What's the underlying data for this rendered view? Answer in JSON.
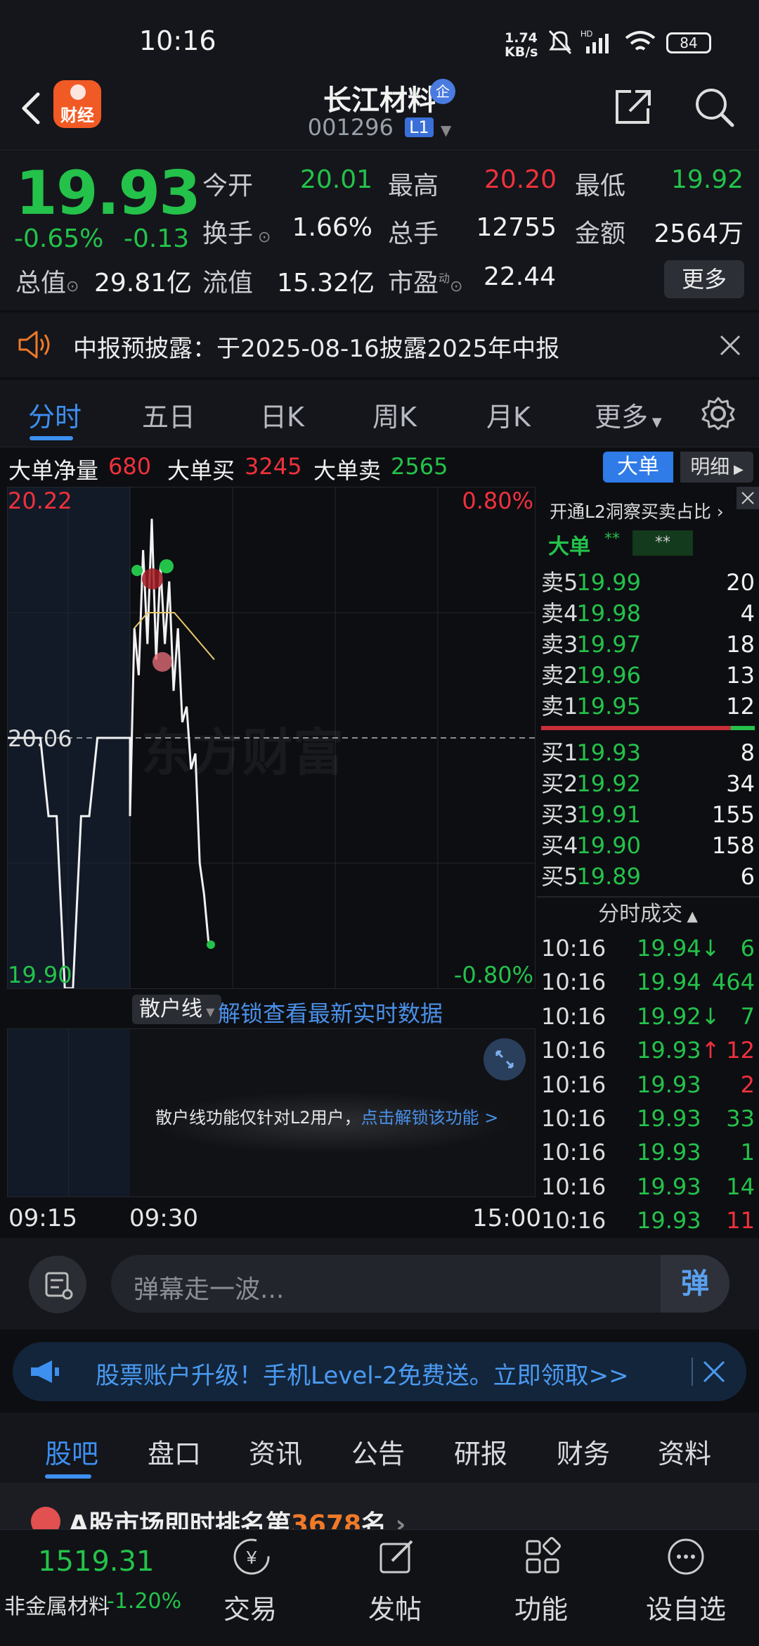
{
  "status_bar": {
    "time": "10:16",
    "net_speed_value": "1.74",
    "net_speed_unit": "KB/s",
    "battery": "84"
  },
  "header": {
    "app_badge": "财经",
    "stock_name": "长江材料",
    "verified_badge": "企",
    "stock_code": "001296",
    "level": "L1"
  },
  "quote": {
    "price": "19.93",
    "change_pct": "-0.65%",
    "change_amt": "-0.13",
    "open_label": "今开",
    "open": "20.01",
    "high_label": "最高",
    "high": "20.20",
    "low_label": "最低",
    "low": "19.92",
    "turnover_label": "换手",
    "turnover": "1.66%",
    "volume_label": "总手",
    "volume": "12755",
    "amount_label": "金额",
    "amount": "2564万",
    "mktcap_label": "总值",
    "mktcap": "29.81亿",
    "float_label": "流值",
    "float": "15.32亿",
    "pe_label": "市盈",
    "pe_sup": "动",
    "pe": "22.44",
    "more_label": "更多"
  },
  "notice": {
    "text": "中报预披露：于2025-08-16披露2025年中报"
  },
  "chart_tabs": [
    "分时",
    "五日",
    "日K",
    "周K",
    "月K",
    "更多"
  ],
  "big_order": {
    "net_label": "大单净量",
    "net": "680",
    "buy_label": "大单买",
    "buy": "3245",
    "sell_label": "大单卖",
    "sell": "2565",
    "tab_big": "大单",
    "tab_detail": "明细"
  },
  "chart": {
    "top_price": "20.22",
    "top_pct": "0.80%",
    "mid_price": "20.06",
    "bottom_price": "19.90",
    "bottom_pct": "-0.80%",
    "watermark": "东方财富"
  },
  "chart_data": {
    "type": "line",
    "x_ticks": [
      "09:15",
      "09:30",
      "15:00"
    ],
    "ylim": [
      19.9,
      20.22
    ],
    "series": [
      {
        "values": [
          20.06,
          20.06,
          20.06,
          20.06,
          20.06,
          20.01,
          20.01,
          19.9,
          19.9,
          20.01,
          20.01,
          20.06,
          20.06,
          20.06,
          20.06,
          20.06,
          20.01,
          20.13,
          20.1,
          20.18,
          20.12,
          20.2,
          20.11,
          20.17,
          20.12,
          20.16,
          20.09,
          20.13,
          20.07,
          20.08,
          20.04,
          20.05,
          19.98,
          19.96,
          19.93
        ]
      },
      {
        "values": [
          20.13,
          20.14,
          20.14,
          20.14,
          20.13,
          20.12,
          20.11
        ]
      }
    ]
  },
  "lower": {
    "selector": "散户线",
    "unlock_link": "解锁查看最新实时数据",
    "notice": "散户线功能仅针对L2用户，",
    "notice_link": "点击解锁该功能 >"
  },
  "order_book": {
    "l2_link": "开通L2洞察买卖占比",
    "big_label": "大单",
    "big_val1": "**",
    "big_val2": "**",
    "asks": [
      {
        "label": "卖5",
        "price": "19.99",
        "vol": "20"
      },
      {
        "label": "卖4",
        "price": "19.98",
        "vol": "4"
      },
      {
        "label": "卖3",
        "price": "19.97",
        "vol": "18"
      },
      {
        "label": "卖2",
        "price": "19.96",
        "vol": "13"
      },
      {
        "label": "卖1",
        "price": "19.95",
        "vol": "12"
      }
    ],
    "bids": [
      {
        "label": "买1",
        "price": "19.93",
        "vol": "8"
      },
      {
        "label": "买2",
        "price": "19.92",
        "vol": "34"
      },
      {
        "label": "买3",
        "price": "19.91",
        "vol": "155"
      },
      {
        "label": "买4",
        "price": "19.90",
        "vol": "158"
      },
      {
        "label": "买5",
        "price": "19.89",
        "vol": "6"
      }
    ],
    "ticks_title": "分时成交",
    "ticks": [
      {
        "time": "10:16",
        "price": "19.94↓",
        "vol": "6",
        "dir": "down"
      },
      {
        "time": "10:16",
        "price": "19.94",
        "vol": "464",
        "dir": "down"
      },
      {
        "time": "10:16",
        "price": "19.92↓",
        "vol": "7",
        "dir": "down"
      },
      {
        "time": "10:16",
        "price": "19.93↑",
        "vol": "12",
        "dir": "up"
      },
      {
        "time": "10:16",
        "price": "19.93",
        "vol": "2",
        "dir": "up"
      },
      {
        "time": "10:16",
        "price": "19.93",
        "vol": "33",
        "dir": "down"
      },
      {
        "time": "10:16",
        "price": "19.93",
        "vol": "1",
        "dir": "down"
      },
      {
        "time": "10:16",
        "price": "19.93",
        "vol": "14",
        "dir": "down"
      },
      {
        "time": "10:16",
        "price": "19.93",
        "vol": "11",
        "dir": "up"
      }
    ]
  },
  "danmu": {
    "placeholder": "弹幕走一波...",
    "send_icon_text": "弹"
  },
  "promo": {
    "text": "股票账户升级！手机Level-2免费送。立即领取>>"
  },
  "bottom_tabs": [
    "股吧",
    "盘口",
    "资讯",
    "公告",
    "研报",
    "财务",
    "资料"
  ],
  "rank": {
    "prefix": "A股市场即时排名第",
    "number": "3678",
    "suffix": "名"
  },
  "bottom_nav": {
    "index_value": "1519.31",
    "index_name": "非金属材料",
    "index_change": "-1.20%",
    "items": [
      "交易",
      "发帖",
      "功能",
      "设自选"
    ]
  },
  "colors": {
    "up": "#f0313c",
    "down": "#24c24a",
    "accent": "#3d8ff0",
    "brand": "#f15a24"
  }
}
